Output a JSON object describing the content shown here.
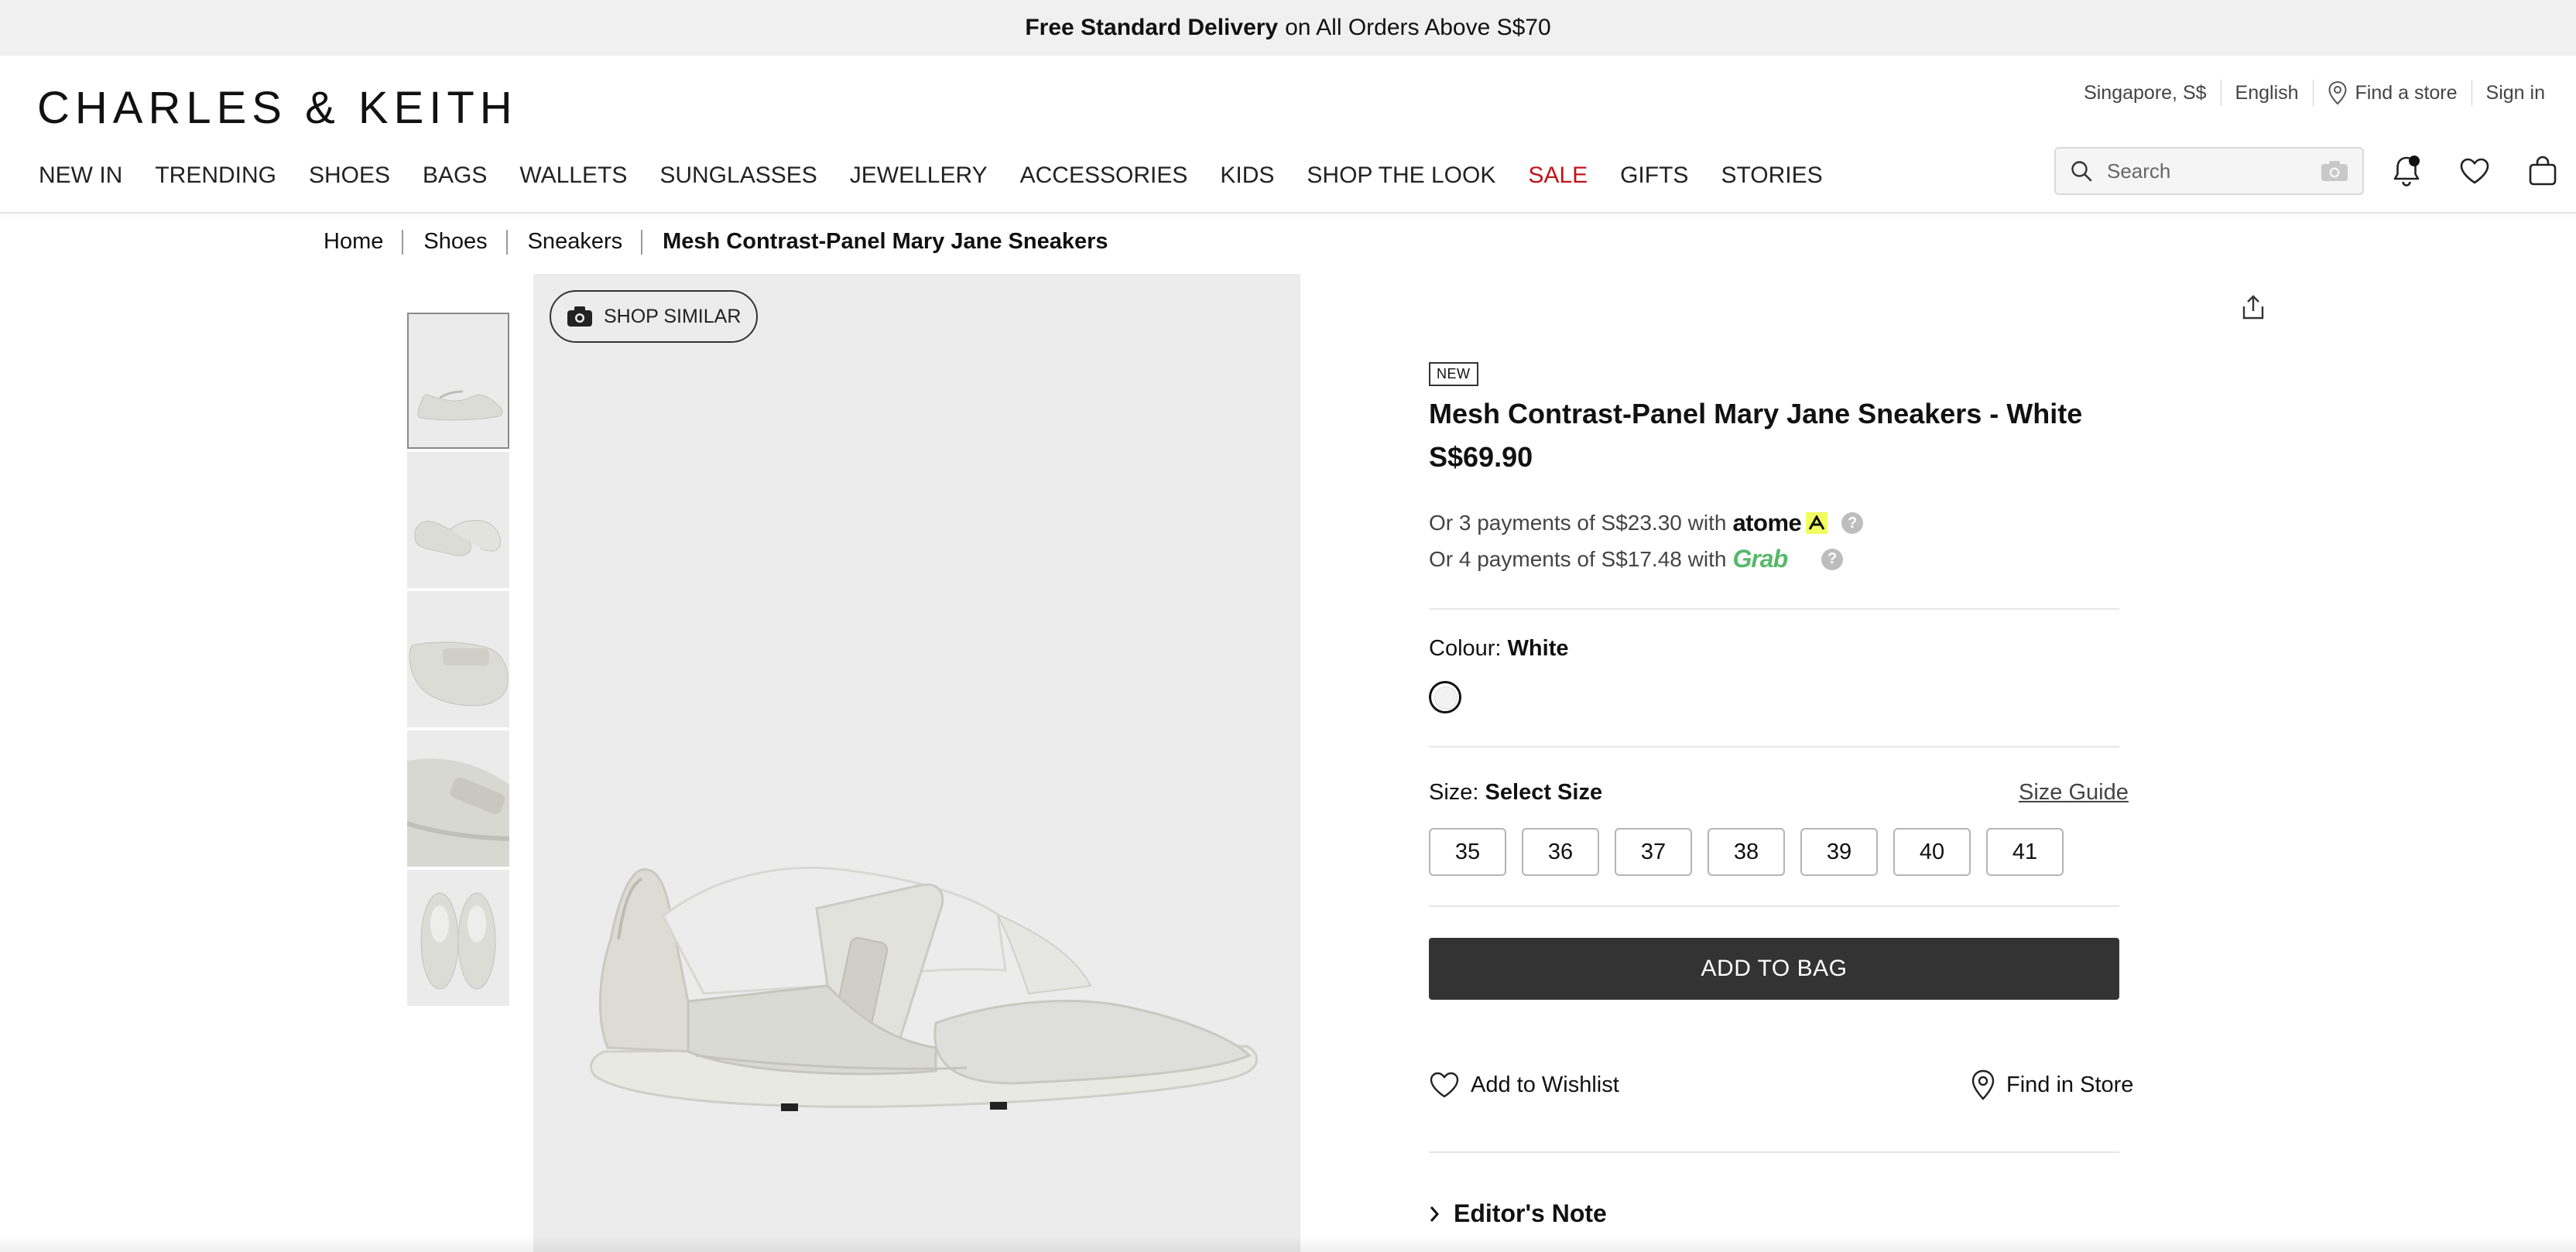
{
  "promo": {
    "bold": "Free Standard Delivery",
    "rest": "on All Orders Above S$70"
  },
  "header": {
    "logo": "CHARLES & KEITH",
    "region": "Singapore, S$",
    "language": "English",
    "find_store": "Find a store",
    "sign_in": "Sign in",
    "search_placeholder": "Search"
  },
  "nav": {
    "items": [
      "NEW IN",
      "TRENDING",
      "SHOES",
      "BAGS",
      "WALLETS",
      "SUNGLASSES",
      "JEWELLERY",
      "ACCESSORIES",
      "KIDS",
      "SHOP THE LOOK",
      "SALE",
      "GIFTS",
      "STORIES"
    ],
    "sale_color": "#c0141b"
  },
  "breadcrumb": [
    "Home",
    "Shoes",
    "Sneakers",
    "Mesh Contrast-Panel Mary Jane Sneakers"
  ],
  "gallery": {
    "shop_similar": "SHOP SIMILAR"
  },
  "product": {
    "badge": "NEW",
    "title": "Mesh Contrast-Panel Mary Jane Sneakers - White",
    "price": "S$69.90",
    "pay1_text": "Or 3 payments of S$23.30 with",
    "pay1_brand": "atome",
    "pay2_text": "Or 4 payments of S$17.48 with",
    "pay2_brand": "Grab",
    "colour_label": "Colour:",
    "colour_value": "White",
    "size_label": "Size:",
    "size_value": "Select Size",
    "size_guide": "Size Guide",
    "sizes": [
      "35",
      "36",
      "37",
      "38",
      "39",
      "40",
      "41"
    ],
    "add_to_bag": "ADD TO BAG",
    "wishlist": "Add to Wishlist",
    "find_in_store": "Find in Store",
    "editors_note": "Editor's Note"
  },
  "colors": {
    "accent_dark": "#333333",
    "image_bg": "#ececec",
    "grab_green": "#58b86a",
    "atome_yellow": "#f0ff5f"
  }
}
